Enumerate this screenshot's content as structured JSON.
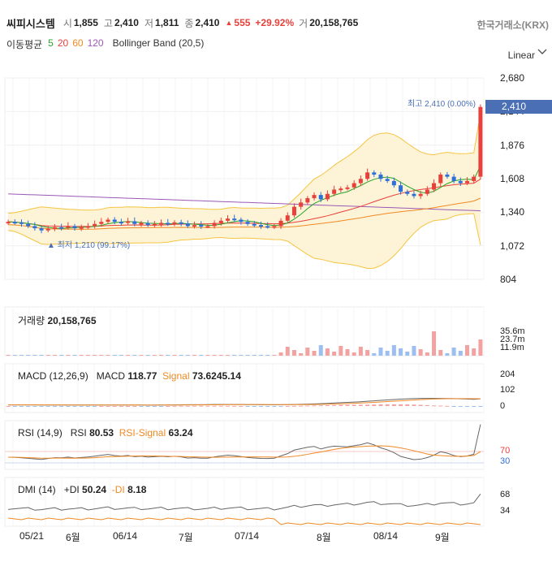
{
  "header": {
    "stock_name": "씨피시스템",
    "open_label": "시",
    "open": "1,855",
    "high_label": "고",
    "high": "2,410",
    "low_label": "저",
    "low": "1,811",
    "close_label": "종",
    "close": "2,410",
    "change_arrow": "▲",
    "change": "555",
    "change_pct": "+29.92%",
    "volume_label": "거",
    "volume": "20,158,765",
    "exchange": "한국거래소(KRX)"
  },
  "indicators": {
    "ma_label": "이동평균",
    "ma5": "5",
    "ma20": "20",
    "ma60": "60",
    "ma120": "120",
    "bollinger": "Bollinger Band (20,5)",
    "scale_mode": "Linear",
    "scale_icon": "chevron-down-icon"
  },
  "price_axis": [
    "2,680",
    "2,144",
    "1,876",
    "1,608",
    "1,340",
    "1,072",
    "804"
  ],
  "price_tag": "2,410",
  "high_marker": "최고 2,410 (0.00%)",
  "low_marker": "▲ 최저 1,210 (99.17%)",
  "volume_panel": {
    "label": "거래량",
    "value": "20,158,765",
    "axis": [
      "35.6m",
      "23.7m",
      "11.9m"
    ]
  },
  "macd_panel": {
    "label": "MACD (12,26,9)",
    "macd_label": "MACD",
    "macd_value": "118.77",
    "signal_label": "Signal",
    "signal_value": "73.6245.14",
    "axis": [
      "204",
      "102",
      "0"
    ]
  },
  "rsi_panel": {
    "label": "RSI (14,9)",
    "rsi_label": "RSI",
    "rsi_value": "80.53",
    "signal_label": "RSI-Signal",
    "signal_value": "63.24",
    "axis": [
      "70",
      "30"
    ]
  },
  "dmi_panel": {
    "label": "DMI (14)",
    "pdi_label": "+DI",
    "pdi_value": "50.24",
    "mdi_label": "-DI",
    "mdi_value": "8.18",
    "axis": [
      "68",
      "34"
    ]
  },
  "x_axis": [
    "05/21",
    "6월",
    "06/14",
    "7월",
    "07/14",
    "8월",
    "08/14",
    "9월"
  ],
  "colors": {
    "up": "#e8413c",
    "down": "#2f6fd8",
    "ma5": "#29a329",
    "ma20": "#e8413c",
    "ma60": "#f08a24",
    "ma120": "#9b59b6",
    "band": "#f5c542",
    "tag": "#4a6fb5"
  },
  "chart_data": {
    "type": "candlestick",
    "price_range": [
      804,
      2680
    ],
    "closes": [
      1340,
      1335,
      1320,
      1300,
      1280,
      1260,
      1275,
      1290,
      1285,
      1300,
      1280,
      1290,
      1300,
      1320,
      1340,
      1360,
      1340,
      1330,
      1345,
      1320,
      1330,
      1310,
      1320,
      1330,
      1320,
      1335,
      1325,
      1300,
      1310,
      1300,
      1300,
      1330,
      1350,
      1370,
      1360,
      1340,
      1320,
      1310,
      1300,
      1295,
      1300,
      1350,
      1400,
      1480,
      1520,
      1560,
      1590,
      1550,
      1600,
      1640,
      1650,
      1660,
      1700,
      1740,
      1800,
      1780,
      1740,
      1720,
      1680,
      1620,
      1600,
      1580,
      1600,
      1640,
      1700,
      1780,
      1760,
      1720,
      1700,
      1720,
      1760,
      2410
    ]
  }
}
